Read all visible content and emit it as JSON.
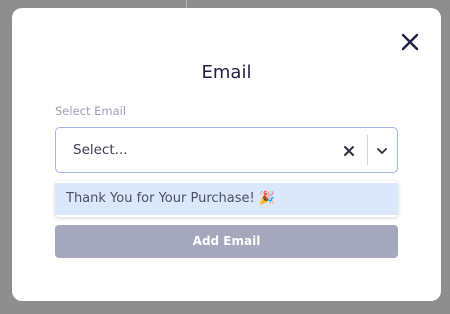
{
  "modal": {
    "title": "Email",
    "close_icon": "close-icon"
  },
  "email_select": {
    "label": "Select Email",
    "placeholder": "Select...",
    "clear_icon": "clear-icon",
    "dropdown_icon": "chevron-down-icon",
    "options": [
      {
        "label": "Thank You for Your Purchase! 🎉"
      }
    ]
  },
  "actions": {
    "add_label": "Add Email"
  },
  "colors": {
    "overlay": "#8e8e8e",
    "title": "#1f2142",
    "select_border": "#9db7e6",
    "option_highlight": "#dbe8fb",
    "add_button": "#a5a7bd"
  }
}
